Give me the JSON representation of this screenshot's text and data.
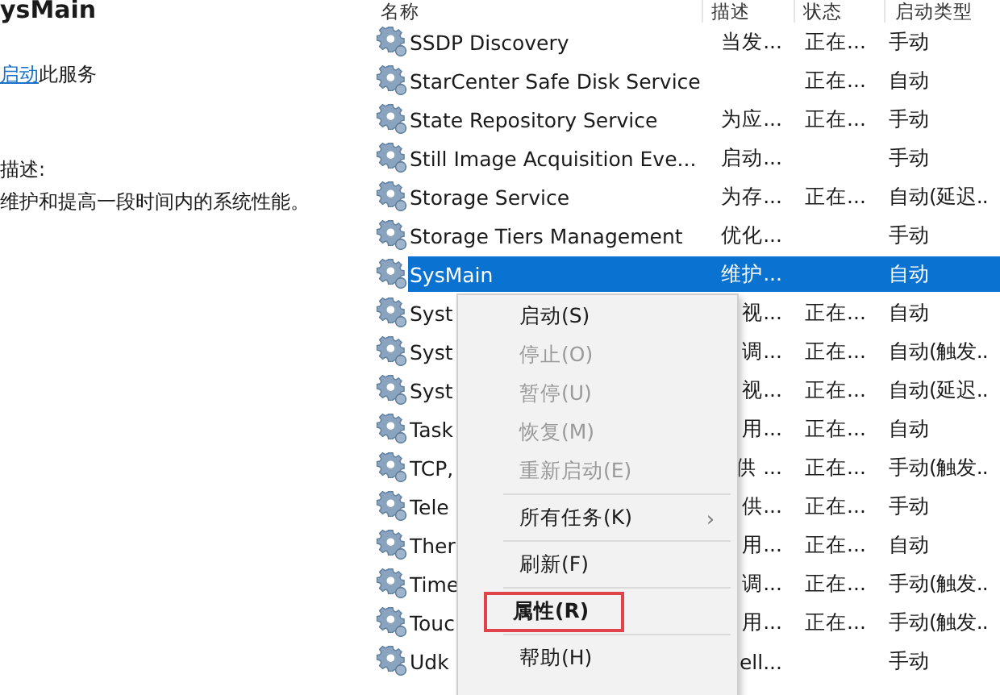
{
  "detail": {
    "title": "ysMain",
    "action_link": "启动",
    "action_text": "此服务",
    "description_label": "描述:",
    "description": "维护和提高一段时间内的系统性能。"
  },
  "table": {
    "columns": [
      "名称",
      "描述",
      "状态",
      "启动类型"
    ],
    "rows": [
      {
        "name": "SSDP Discovery",
        "description": "当发...",
        "status": "正在...",
        "startup": "手动",
        "selected": false
      },
      {
        "name": "StarCenter Safe Disk Service",
        "description": "",
        "status": "正在...",
        "startup": "自动",
        "selected": false
      },
      {
        "name": "State Repository Service",
        "description": "为应...",
        "status": "正在...",
        "startup": "手动",
        "selected": false
      },
      {
        "name": "Still Image Acquisition Eve...",
        "description": "启动...",
        "status": "",
        "startup": "手动",
        "selected": false
      },
      {
        "name": "Storage Service",
        "description": "为存...",
        "status": "正在...",
        "startup": "自动(延迟..",
        "selected": false
      },
      {
        "name": "Storage Tiers Management",
        "description": "优化...",
        "status": "",
        "startup": "手动",
        "selected": false
      },
      {
        "name": "SysMain",
        "description": "维护...",
        "status": "",
        "startup": "自动",
        "selected": true
      },
      {
        "name": "Syst",
        "description": "视...",
        "status": "正在...",
        "startup": "自动",
        "selected": false
      },
      {
        "name": "Syst",
        "description": "调...",
        "status": "正在...",
        "startup": "自动(触发..",
        "selected": false
      },
      {
        "name": "Syst",
        "description": "视...",
        "status": "正在...",
        "startup": "自动(延迟..",
        "selected": false
      },
      {
        "name": "Task",
        "description": "用...",
        "status": "正在...",
        "startup": "自动",
        "selected": false
      },
      {
        "name": "TCP,",
        "description": "供 ...",
        "status": "正在...",
        "startup": "手动(触发..",
        "selected": false
      },
      {
        "name": "Tele",
        "description": "供...",
        "status": "正在...",
        "startup": "手动",
        "selected": false
      },
      {
        "name": "Ther",
        "description": "用...",
        "status": "正在...",
        "startup": "自动",
        "selected": false
      },
      {
        "name": "Time",
        "description": "调...",
        "status": "正在...",
        "startup": "手动(触发..",
        "selected": false
      },
      {
        "name": "Touc",
        "description": "用...",
        "status": "正在...",
        "startup": "手动(触发..",
        "selected": false
      },
      {
        "name": "Udk",
        "description": "ell...",
        "status": "",
        "startup": "手动",
        "selected": false
      }
    ]
  },
  "context_menu": {
    "items": [
      {
        "kind": "item",
        "label": "启动(S)",
        "disabled": false,
        "bold": false,
        "outlined": false
      },
      {
        "kind": "item",
        "label": "停止(O)",
        "disabled": true,
        "bold": false,
        "outlined": false
      },
      {
        "kind": "item",
        "label": "暂停(U)",
        "disabled": true,
        "bold": false,
        "outlined": false
      },
      {
        "kind": "item",
        "label": "恢复(M)",
        "disabled": true,
        "bold": false,
        "outlined": false
      },
      {
        "kind": "item",
        "label": "重新启动(E)",
        "disabled": true,
        "bold": false,
        "outlined": false
      },
      {
        "kind": "separator"
      },
      {
        "kind": "item",
        "label": "所有任务(K)",
        "disabled": false,
        "bold": false,
        "outlined": false,
        "submenu": "›"
      },
      {
        "kind": "separator"
      },
      {
        "kind": "item",
        "label": "刷新(F)",
        "disabled": false,
        "bold": false,
        "outlined": false
      },
      {
        "kind": "separator"
      },
      {
        "kind": "item",
        "label": "属性(R)",
        "disabled": false,
        "bold": true,
        "outlined": true
      },
      {
        "kind": "separator"
      },
      {
        "kind": "item",
        "label": "帮助(H)",
        "disabled": false,
        "bold": false,
        "outlined": false
      }
    ]
  }
}
